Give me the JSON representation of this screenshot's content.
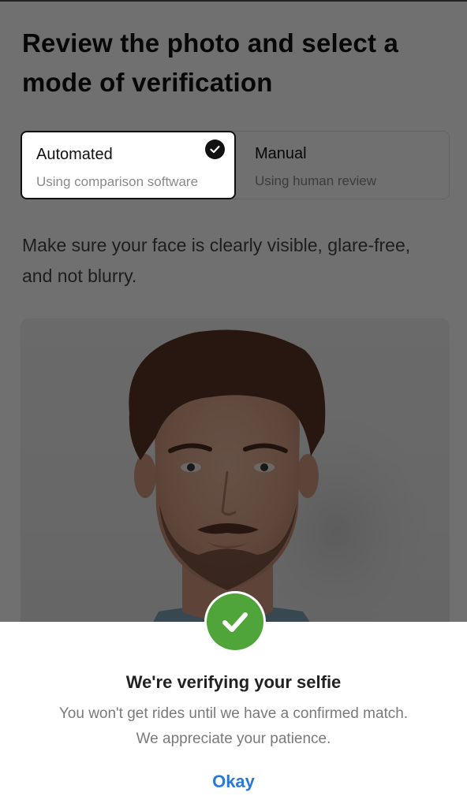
{
  "page": {
    "title": "Review the photo and select a mode of verification",
    "instruction": "Make sure your face is clearly visible, glare-free, and not blurry."
  },
  "modes": [
    {
      "label": "Automated",
      "description": "Using comparison software",
      "selected": true
    },
    {
      "label": "Manual",
      "description": "Using human review",
      "selected": false
    }
  ],
  "photo": {
    "subject": "selfie of young man with beard"
  },
  "dialog": {
    "icon": "check-circle-icon",
    "title": "We're verifying your selfie",
    "body": "You won't get rides until we have a confirmed match. We appreciate your patience.",
    "action_label": "Okay"
  },
  "colors": {
    "success": "#4fa43a",
    "link": "#2b78d6",
    "selected_border": "#111111"
  }
}
